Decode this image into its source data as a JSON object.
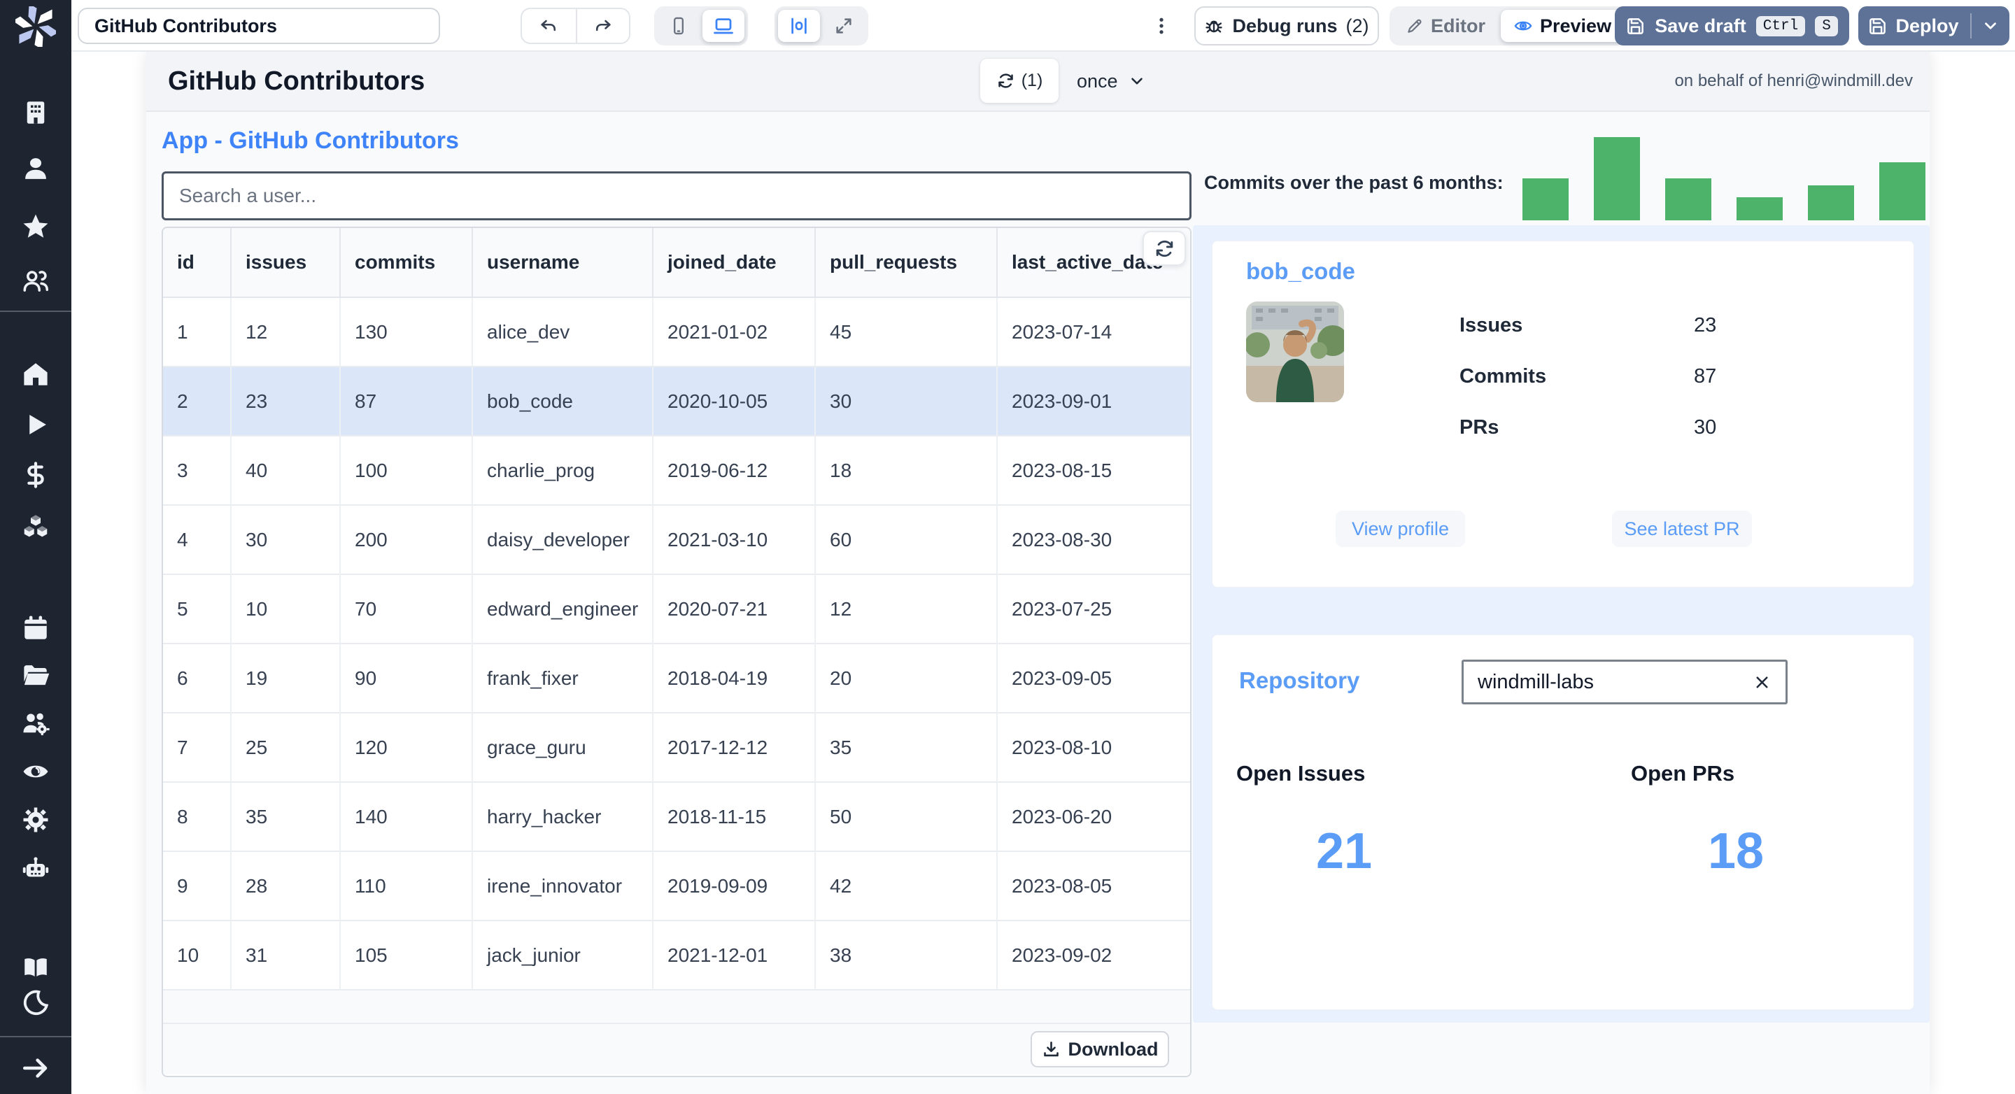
{
  "topbar": {
    "app_title": "GitHub Contributors",
    "debug_runs_label": "Debug runs",
    "debug_runs_count": "(2)",
    "editor_label": "Editor",
    "preview_label": "Preview",
    "save_draft_label": "Save draft",
    "kbd_ctrl": "Ctrl",
    "kbd_s": "S",
    "deploy_label": "Deploy"
  },
  "sidebar": {
    "icons": [
      "windmill-logo",
      "building",
      "user",
      "star",
      "user-group",
      "home",
      "play",
      "dollar",
      "cubes",
      "calendar",
      "folder",
      "user-group-gear",
      "eye",
      "gear",
      "robot",
      "book",
      "moon",
      "arrow-right"
    ]
  },
  "app_header": {
    "title": "GitHub Contributors",
    "refresh_count": "(1)",
    "schedule": "once",
    "on_behalf": "on behalf of henri@windmill.dev"
  },
  "main": {
    "heading": "App - GitHub Contributors",
    "search_placeholder": "Search a user...",
    "download_label": "Download"
  },
  "table": {
    "columns": [
      "id",
      "issues",
      "commits",
      "username",
      "joined_date",
      "pull_requests",
      "last_active_date"
    ],
    "rows": [
      [
        "1",
        "12",
        "130",
        "alice_dev",
        "2021-01-02",
        "45",
        "2023-07-14"
      ],
      [
        "2",
        "23",
        "87",
        "bob_code",
        "2020-10-05",
        "30",
        "2023-09-01"
      ],
      [
        "3",
        "40",
        "100",
        "charlie_prog",
        "2019-06-12",
        "18",
        "2023-08-15"
      ],
      [
        "4",
        "30",
        "200",
        "daisy_developer",
        "2021-03-10",
        "60",
        "2023-08-30"
      ],
      [
        "5",
        "10",
        "70",
        "edward_engineer",
        "2020-07-21",
        "12",
        "2023-07-25"
      ],
      [
        "6",
        "19",
        "90",
        "frank_fixer",
        "2018-04-19",
        "20",
        "2023-09-05"
      ],
      [
        "7",
        "25",
        "120",
        "grace_guru",
        "2017-12-12",
        "35",
        "2023-08-10"
      ],
      [
        "8",
        "35",
        "140",
        "harry_hacker",
        "2018-11-15",
        "50",
        "2023-06-20"
      ],
      [
        "9",
        "28",
        "110",
        "irene_innovator",
        "2019-09-09",
        "42",
        "2023-08-05"
      ],
      [
        "10",
        "31",
        "105",
        "jack_junior",
        "2021-12-01",
        "38",
        "2023-09-02"
      ]
    ],
    "highlighted_row_index": 1
  },
  "chart_data": {
    "type": "bar",
    "title": "Commits over the past 6 months:",
    "values": [
      50,
      100,
      50,
      28,
      42,
      70
    ],
    "ylim": [
      0,
      100
    ],
    "color": "#4db36a",
    "legend": "none",
    "grid": false
  },
  "user_card": {
    "title": "bob_code",
    "stats": [
      {
        "label": "Issues",
        "value": "23"
      },
      {
        "label": "Commits",
        "value": "87"
      },
      {
        "label": "PRs",
        "value": "30"
      }
    ],
    "view_profile_label": "View profile",
    "see_latest_pr_label": "See latest PR"
  },
  "repo_card": {
    "title": "Repository",
    "input_value": "windmill-labs",
    "open_issues_label": "Open Issues",
    "open_prs_label": "Open PRs",
    "open_issues_value": "21",
    "open_prs_value": "18"
  },
  "colors": {
    "accent_blue": "#3f83f8",
    "card_link_blue": "#5b9cf6",
    "bar_green": "#4db36a",
    "highlight_row": "#dbe7f8",
    "panel_blue": "#e8f1fd",
    "button_slate": "#5d7296",
    "sidebar_dark": "#1e2430"
  }
}
